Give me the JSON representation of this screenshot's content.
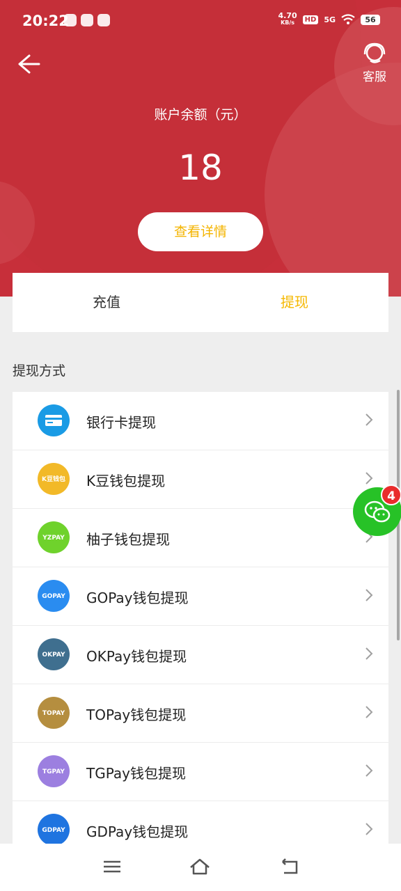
{
  "status_bar": {
    "time": "20:22",
    "net_speed_value": "4.70",
    "net_speed_unit": "KB/s",
    "hd_label": "HD",
    "signal_label": "5G",
    "battery_level": "56"
  },
  "header": {
    "service_label": "客服",
    "balance_label": "账户余额（元）",
    "balance_value": "18",
    "detail_button": "查看详情"
  },
  "tabs": [
    {
      "label": "充值",
      "active": false
    },
    {
      "label": "提现",
      "active": true
    }
  ],
  "section_title": "提现方式",
  "withdraw_methods": [
    {
      "label": "银行卡提现",
      "icon": "bank-card-icon",
      "logo_text": "",
      "color": "#1a9be5"
    },
    {
      "label": "K豆钱包提现",
      "icon": "kdou-wallet-logo",
      "logo_text": "K豆钱包",
      "color": "#f2b928"
    },
    {
      "label": "柚子钱包提现",
      "icon": "yzpay-logo",
      "logo_text": "YZPAY",
      "color": "#6fd22c"
    },
    {
      "label": "GOPay钱包提现",
      "icon": "gopay-logo",
      "logo_text": "GOPAY",
      "color": "#2a8cf0"
    },
    {
      "label": "OKPay钱包提现",
      "icon": "okpay-logo",
      "logo_text": "OKPAY",
      "color": "#3f6f8f"
    },
    {
      "label": "TOPay钱包提现",
      "icon": "topay-logo",
      "logo_text": "TOPAY",
      "color": "#b58e3f"
    },
    {
      "label": "TGPay钱包提现",
      "icon": "tgpay-logo",
      "logo_text": "TGPAY",
      "color": "#9c7fe0"
    },
    {
      "label": "GDPay钱包提现",
      "icon": "gdpay-logo",
      "logo_text": "GDPAY",
      "color": "#1f74e0"
    }
  ],
  "chat_float": {
    "badge": "4"
  },
  "colors": {
    "header_red": "#c72f3a",
    "accent_yellow": "#f5b800",
    "chat_green": "#27c227"
  }
}
